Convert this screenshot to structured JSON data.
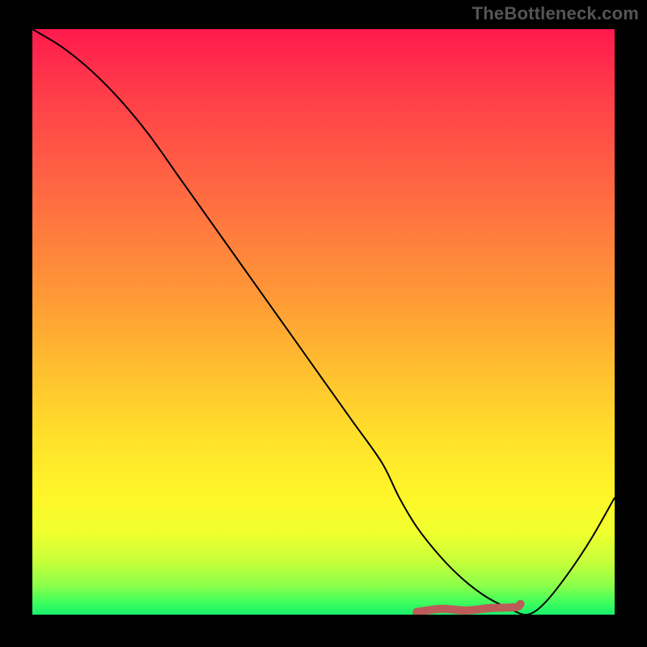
{
  "attribution": "TheBottleneck.com",
  "colors": {
    "background": "#000000",
    "curve_stroke": "#000000",
    "marker_stroke": "#bb5c58",
    "gradient_top": "#ff1a4d",
    "gradient_bottom": "#18ef6a"
  },
  "chart_data": {
    "type": "line",
    "title": "",
    "xlabel": "",
    "ylabel": "",
    "xlim": [
      0,
      100
    ],
    "ylim": [
      0,
      100
    ],
    "series": [
      {
        "name": "bottleneck-curve",
        "x": [
          0,
          5,
          10,
          15,
          20,
          25,
          30,
          35,
          40,
          45,
          50,
          55,
          60,
          63,
          66,
          70,
          74,
          78,
          82,
          85,
          88,
          92,
          96,
          100
        ],
        "values": [
          100,
          97,
          93,
          88,
          82,
          75,
          68,
          61,
          54,
          47,
          40,
          33,
          26,
          20,
          15,
          10,
          6,
          3,
          1,
          0,
          2,
          7,
          13,
          20
        ]
      }
    ],
    "annotations": [
      {
        "name": "optimal-range-marker",
        "x_range": [
          66,
          83
        ],
        "y": 1,
        "color": "#bb5c58"
      }
    ]
  }
}
